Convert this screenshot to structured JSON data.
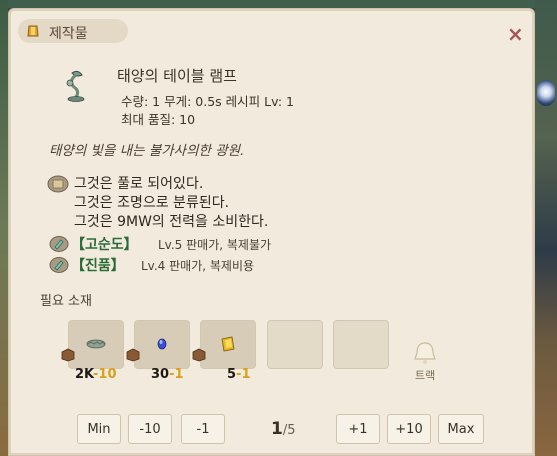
{
  "window": {
    "title": "제작물",
    "close_label": "×"
  },
  "item": {
    "name": "태양의 테이블 램프",
    "stats": "수량: 1 무게: 0.5s   레시피 Lv: 1",
    "max_quality": "최대 품질: 10",
    "description": "태양의 빛을 내는 불가사의한 광원."
  },
  "properties": [
    "그것은 풀로 되어있다.",
    "그것은 조명으로 분류된다.",
    "그것은 9MW의 전력을 소비한다."
  ],
  "grades": [
    {
      "name": "【고순도】",
      "info": "Lv.5 판매가, 복제불가"
    },
    {
      "name": "【진품】",
      "info": "Lv.4 판매가, 복제비용"
    }
  ],
  "materials": {
    "label": "필요 소재",
    "slots": [
      {
        "have": "2K",
        "need": "-10",
        "icon": "grass-bundle-icon"
      },
      {
        "have": "30",
        "need": "-1",
        "icon": "blue-gem-icon"
      },
      {
        "have": "5",
        "need": "-1",
        "icon": "gold-ingot-icon"
      }
    ],
    "track_label": "트랙"
  },
  "buttons": {
    "min": "Min",
    "minus10": "-10",
    "minus1": "-1",
    "plus1": "+1",
    "plus10": "+10",
    "max": "Max"
  },
  "pager": {
    "current": "1",
    "total": "/5"
  },
  "colors": {
    "panel_bg": "#f2ebdd",
    "grade_name": "#2b6b3a",
    "material_used": "#d8a11b",
    "close": "#a55757"
  }
}
